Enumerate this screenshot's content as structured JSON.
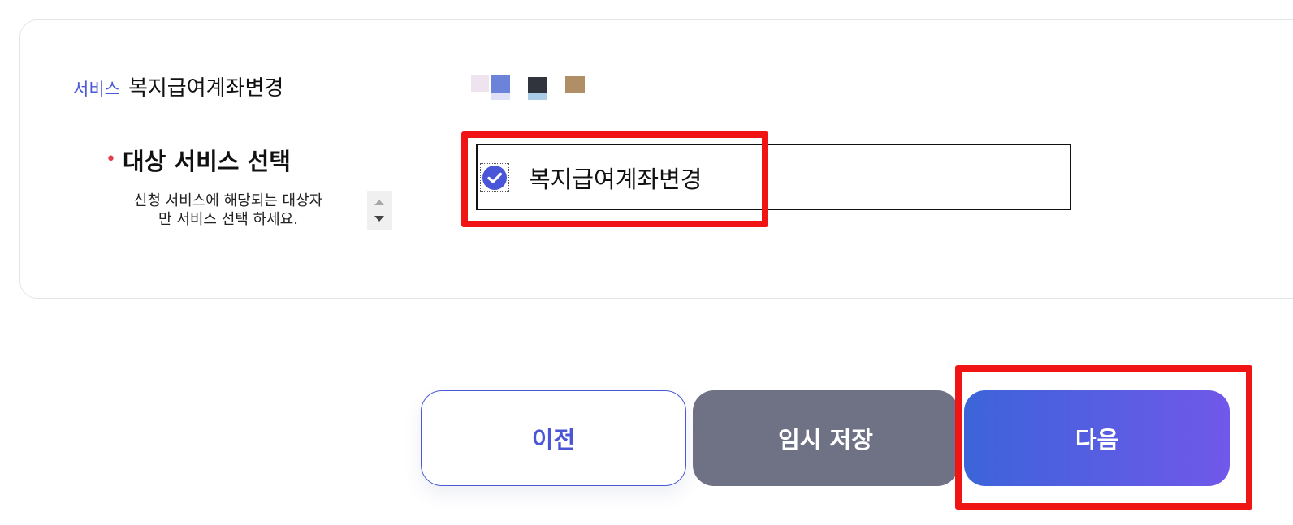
{
  "service": {
    "tag": "서비스",
    "name": "복지급여계좌변경"
  },
  "colors": {
    "accent": "#4a59d8",
    "required_bullet": "#e23c4b",
    "save_button": "#6f7185",
    "next_gradient_start": "#3c64d9",
    "next_gradient_end": "#7058ea",
    "highlight": "#f01414"
  },
  "form": {
    "field_label": "대상 서비스 선택",
    "help_text_line1": "신청 서비스에 해당되는 대상자",
    "help_text_line2": "만 서비스 선택 하세요.",
    "options": [
      {
        "label": "복지급여계좌변경",
        "checked": true,
        "icon": "check-circle-icon"
      }
    ]
  },
  "buttons": {
    "prev_label": "이전",
    "save_label": "임시 저장",
    "next_label": "다음"
  }
}
